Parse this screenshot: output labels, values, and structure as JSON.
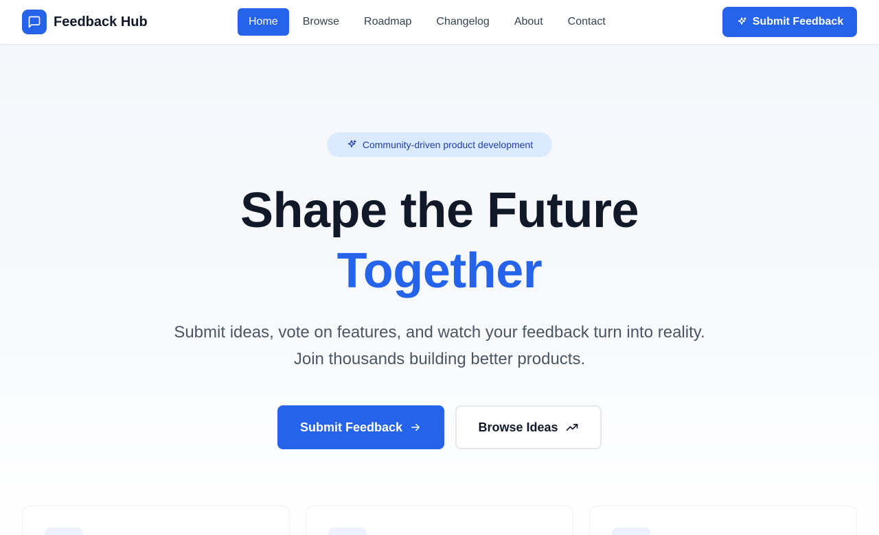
{
  "header": {
    "brand_name": "Feedback Hub",
    "brand_icon": "message-square-icon",
    "nav": [
      {
        "label": "Home",
        "active": true
      },
      {
        "label": "Browse",
        "active": false
      },
      {
        "label": "Roadmap",
        "active": false
      },
      {
        "label": "Changelog",
        "active": false
      },
      {
        "label": "About",
        "active": false
      },
      {
        "label": "Contact",
        "active": false
      }
    ],
    "cta_label": "Submit Feedback",
    "cta_icon": "sparkles-icon"
  },
  "hero": {
    "badge_text": "Community-driven product development",
    "badge_icon": "sparkles-icon",
    "title_line1": "Shape the Future",
    "title_line2": "Together",
    "subtitle": "Submit ideas, vote on features, and watch your feedback turn into reality. Join thousands building better products.",
    "primary_button": "Submit Feedback",
    "primary_icon": "arrow-right-icon",
    "secondary_button": "Browse Ideas",
    "secondary_icon": "trending-up-icon"
  },
  "colors": {
    "accent": "#2563eb",
    "badge_bg": "#dbeafe",
    "text_dark": "#111827",
    "text_muted": "#4b5563"
  }
}
